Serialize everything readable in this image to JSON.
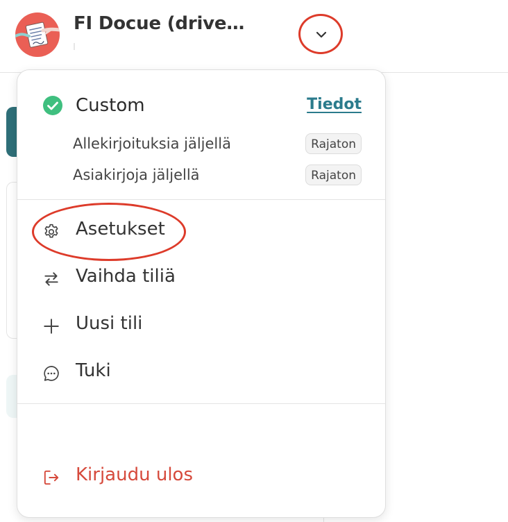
{
  "header": {
    "account_name": "FI Docue (drive…",
    "avatar_icon": "avatar-document-hand-icon",
    "dropdown_icon": "chevron-down-icon"
  },
  "menu": {
    "plan": {
      "name": "Custom",
      "status_icon": "check-circle-icon",
      "details_link": "Tiedot"
    },
    "quotas": [
      {
        "label": "Allekirjoituksia jäljellä",
        "value": "Rajaton"
      },
      {
        "label": "Asiakirjoja jäljellä",
        "value": "Rajaton"
      }
    ],
    "items": [
      {
        "label": "Asetukset",
        "icon": "gear-icon"
      },
      {
        "label": "Vaihda tiliä",
        "icon": "swap-arrows-icon"
      },
      {
        "label": "Uusi tili",
        "icon": "plus-icon"
      },
      {
        "label": "Tuki",
        "icon": "chat-bubble-icon"
      }
    ],
    "logout": {
      "label": "Kirjaudu ulos",
      "icon": "logout-icon"
    }
  },
  "colors": {
    "accent_link": "#2b7b8c",
    "success": "#3fbf7f",
    "danger": "#d64a3c",
    "avatar_bg": "#ea5f55",
    "annotation": "#dd3b2a"
  }
}
